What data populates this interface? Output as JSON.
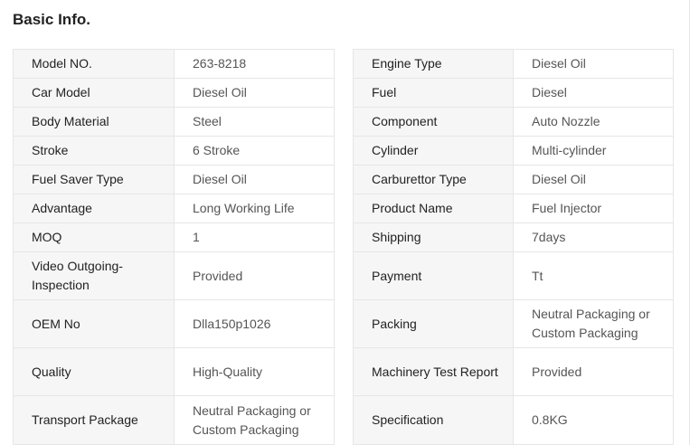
{
  "title": "Basic Info.",
  "left": [
    {
      "label": "Model NO.",
      "value": "263-8218"
    },
    {
      "label": "Car Model",
      "value": "Diesel Oil"
    },
    {
      "label": "Body Material",
      "value": "Steel"
    },
    {
      "label": "Stroke",
      "value": "6 Stroke"
    },
    {
      "label": "Fuel Saver Type",
      "value": "Diesel Oil"
    },
    {
      "label": "Advantage",
      "value": "Long Working Life"
    },
    {
      "label": "MOQ",
      "value": "1"
    },
    {
      "label": "Video Outgoing-Inspection",
      "value": "Provided"
    },
    {
      "label": "OEM No",
      "value": "Dlla150p1026"
    },
    {
      "label": "Quality",
      "value": "High-Quality"
    },
    {
      "label": "Transport Package",
      "value": "Neutral Packaging or Custom Packaging"
    }
  ],
  "right": [
    {
      "label": "Engine Type",
      "value": "Diesel Oil"
    },
    {
      "label": "Fuel",
      "value": "Diesel"
    },
    {
      "label": "Component",
      "value": "Auto Nozzle"
    },
    {
      "label": "Cylinder",
      "value": "Multi-cylinder"
    },
    {
      "label": "Carburettor Type",
      "value": "Diesel Oil"
    },
    {
      "label": "Product Name",
      "value": "Fuel Injector"
    },
    {
      "label": "Shipping",
      "value": "7days"
    },
    {
      "label": "Payment",
      "value": "Tt"
    },
    {
      "label": "Packing",
      "value": "Neutral Packaging or Custom Packaging"
    },
    {
      "label": "Machinery Test Report",
      "value": "Provided"
    },
    {
      "label": "Specification",
      "value": "0.8KG"
    }
  ]
}
